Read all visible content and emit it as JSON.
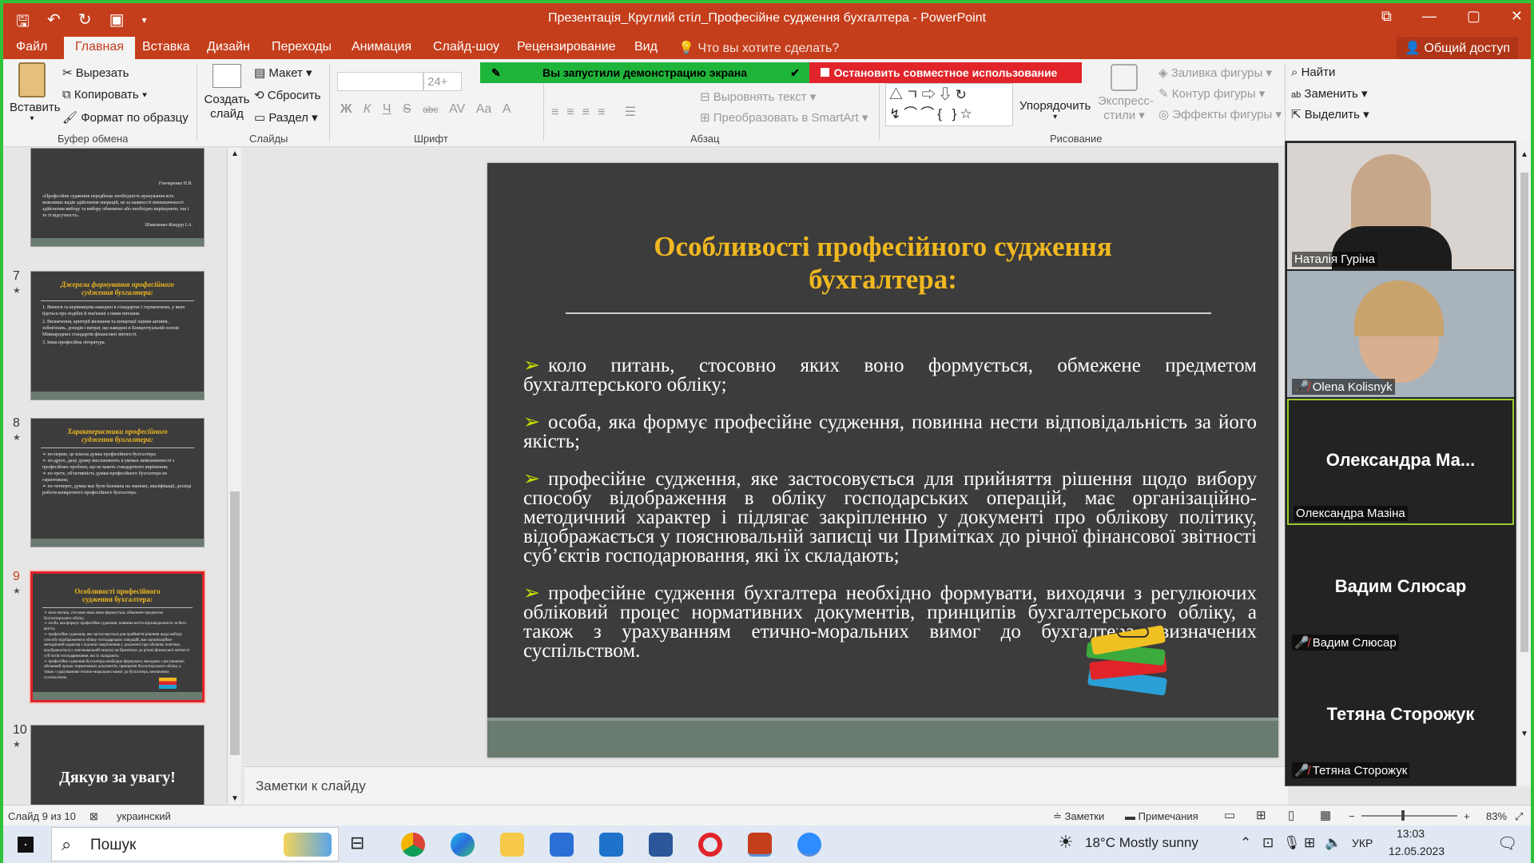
{
  "window": {
    "title": "Презентація_Круглий стіл_Професійне судження бухгалтера - PowerPoint"
  },
  "menu": {
    "tabs": [
      "Файл",
      "Главная",
      "Вставка",
      "Дизайн",
      "Переходы",
      "Анимация",
      "Слайд-шоу",
      "Рецензирование",
      "Вид"
    ],
    "active": "Главная",
    "tell_me": "Что вы хотите сделать?",
    "share": "Общий доступ"
  },
  "ribbon": {
    "paste": "Вставить",
    "cut": "Вырезать",
    "copy": "Копировать",
    "format_painter": "Формат по образцу",
    "clipboard": "Буфер обмена",
    "new_slide": "Создать слайд",
    "layout": "Макет",
    "reset": "Сбросить",
    "section": "Раздел",
    "slides": "Слайды",
    "font_size": "24+",
    "font": "Шрифт",
    "paragraph": "Абзац",
    "align_text": "Выровнять текст",
    "smartart": "Преобразовать в SmartArt",
    "arrange": "Упорядочить",
    "quick_styles": "Экспресс-стили",
    "drawing": "Рисование",
    "shape_fill": "Заливка фигуры",
    "shape_outline": "Контур фигуры",
    "shape_effects": "Эффекты фигуры",
    "find": "Найти",
    "replace": "Заменить",
    "select": "Выделить",
    "font_btns": [
      "Ж",
      "К",
      "Ч",
      "S",
      "abc",
      "AV",
      "Aa",
      "A"
    ]
  },
  "screenshare": {
    "green": "Вы запустили демонстрацию экрана",
    "red": "Остановить совместное использование"
  },
  "thumbnails": [
    {
      "num": "7",
      "title": "Джерела формування професійного судження бухгалтера:",
      "body": [
        "1. Вимоги та керівництва наведені в стандартах і тлумаченнях, у яких йдеться про подібні й пов'язані з ними питання.",
        "2. Визначення, критерії визнання та концепції оцінки активів, зобов'язань, доходів і витрат, що наведені в Концептуальній основі Міжнародних стандартів фінансової звітності.",
        "3. Інша професійна література."
      ]
    },
    {
      "num": "8",
      "title": "Характеристики професійного судження бухгалтера:",
      "body": [
        "по-перше, це власна думка професійного бухгалтера;",
        "по-друге, дану думку висловлюють в умовах невизначеності з професійних проблем, що не мають стандартного вирішення;",
        "по-третє, об'єктивність думки професійного бухгалтера не гарантована;",
        "по-четверте, думка має бути базована на знаннях, кваліфікації, досвіді роботи конкретного професійного бухгалтера."
      ]
    },
    {
      "num": "9",
      "title": "Особливості професійного судження бухгалтера:"
    },
    {
      "num": "10",
      "title": "Дякую за увагу!"
    }
  ],
  "thumb6": {
    "sign1": "Гончаренко Н.В.",
    "quote": "«Професійне судження передбачає необхідність врахування всіх можливих видів здійснення операцій, не за наявності невизначеності здійснення вибору та вибору обмежено або необхідно вирішувати, так і то ті відсутності».",
    "sign2": "Шмиленко-Кондур І.А."
  },
  "slide": {
    "title_line1": "Особливості професійного судження",
    "title_line2": "бухгалтера:",
    "bullets": [
      "коло питань, стосовно яких воно формується, обмежене предметом бухгалтерського обліку;",
      "особа, яка формує професійне судження, повинна нести відповідальність за його якість;",
      "професійне судження, яке застосовується для прийняття рішення щодо вибору способу відображення в обліку господарських операцій, має організаційно-методичний характер і підлягає закріпленню у документі про облікову політику, відображається у пояснювальній записці чи Примітках до річної фінансової звітності суб’єктів господарювання, які їх складають;",
      "професійне судження бухгалтера необхідно формувати, виходячи з регулюючих обліковий процес нормативних документів, принципів бухгалтерського обліку, а також з урахуванням етично-моральних вимог до бухгалтера, визначених суспільством."
    ],
    "bullet_glyph": "➢"
  },
  "notes": "Заметки к слайду",
  "participants": [
    {
      "name": "Наталія Гуріна",
      "video": true,
      "muted": false
    },
    {
      "name": "Olena Kolisnyk",
      "video": true,
      "muted": true
    },
    {
      "name": "Олександра Мазіна",
      "display": "Олександра  Ма...",
      "video": false,
      "muted": false,
      "active": true
    },
    {
      "name": "Вадим Слюсар",
      "display": "Вадим Слюсар",
      "video": false,
      "muted": true
    },
    {
      "name": "Тетяна Сторожук",
      "display": "Тетяна Сторожук",
      "video": false,
      "muted": true
    }
  ],
  "status": {
    "slide": "Слайд 9 из 10",
    "lang": "украинский",
    "notes": "Заметки",
    "comments": "Примечания",
    "zoom": "83%"
  },
  "taskbar": {
    "search": "Пошук",
    "weather": "18°C  Mostly sunny",
    "lang": "УКР",
    "time": "13:03",
    "date": "12.05.2023"
  },
  "colors": {
    "accent": "#c43e1c",
    "slide_bg": "#3c3c3c",
    "slide_title": "#f0b820",
    "slide_band": "#6a7b70",
    "green_banner": "#1fb53a",
    "red_banner": "#e0242a"
  }
}
